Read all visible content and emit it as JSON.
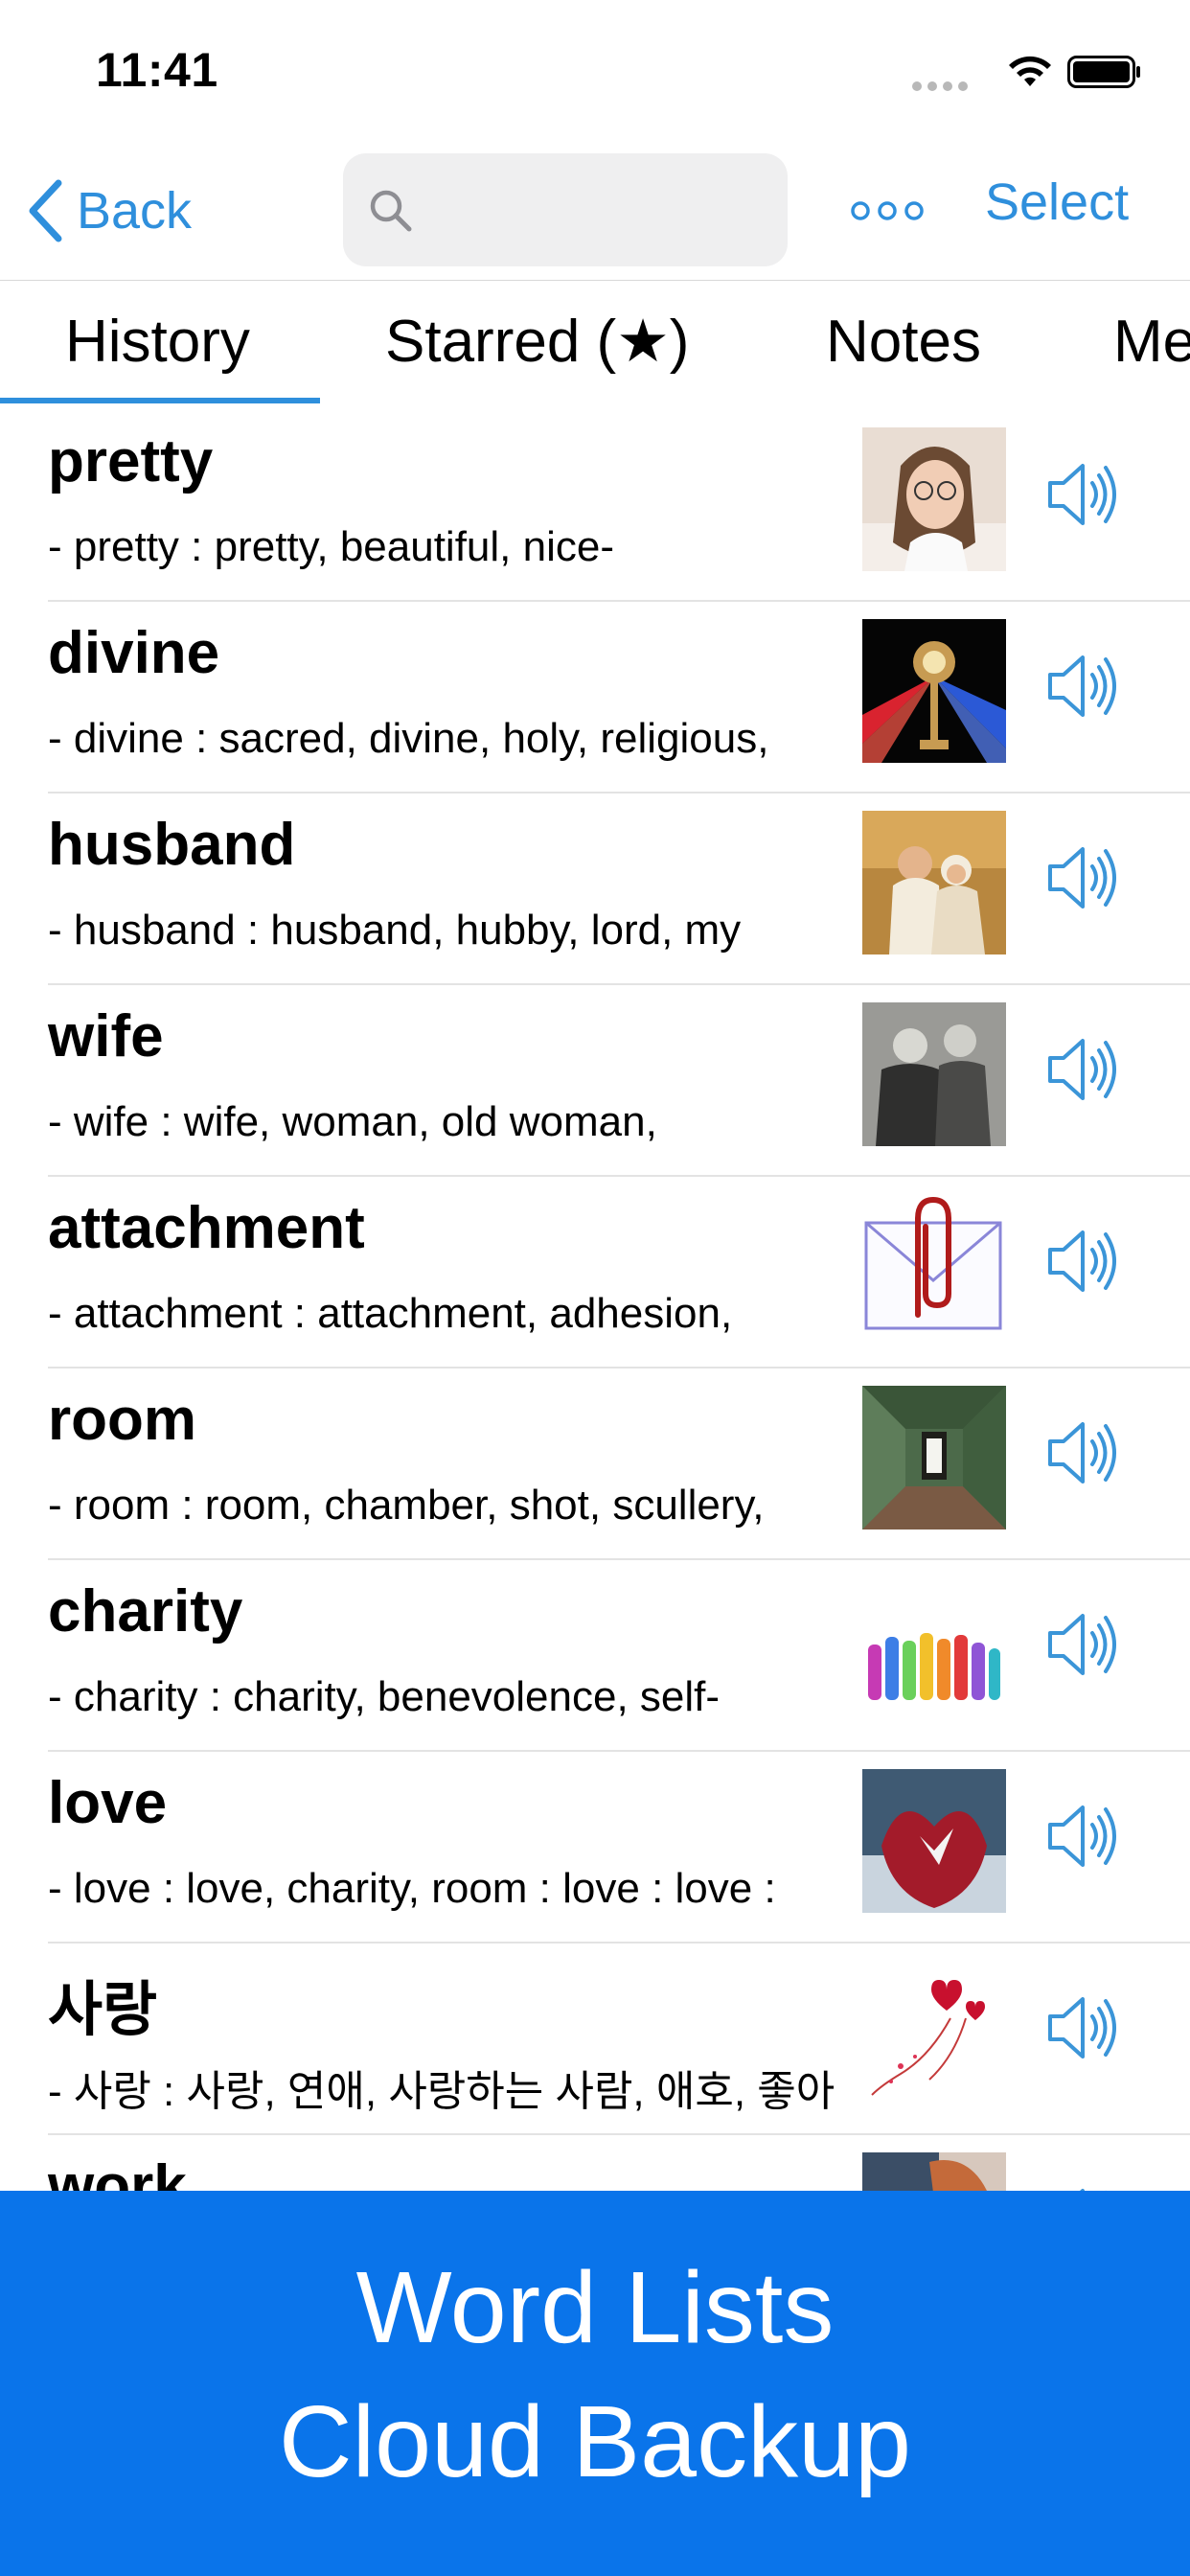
{
  "status": {
    "time": "11:41"
  },
  "nav": {
    "back_label": "Back",
    "search_placeholder": "",
    "select_label": "Select"
  },
  "tabs": [
    {
      "label": "History",
      "active": true
    },
    {
      "label": "Starred (★)",
      "active": false
    },
    {
      "label": "Notes",
      "active": false
    },
    {
      "label": "Me",
      "active": false
    }
  ],
  "words": [
    {
      "word": "pretty",
      "definition": "- pretty : pretty, beautiful, nice-",
      "image": "woman-photo"
    },
    {
      "word": "divine",
      "definition": "- divine : sacred, divine, holy, religious,",
      "image": "divine-light-photo"
    },
    {
      "word": "husband",
      "definition": "- husband : husband, hubby, lord, my",
      "image": "couple-photo"
    },
    {
      "word": "wife",
      "definition": "- wife : wife, woman, old woman,",
      "image": "old-couple-photo"
    },
    {
      "word": "attachment",
      "definition": "- attachment : attachment, adhesion,",
      "image": "paperclip-envelope"
    },
    {
      "word": "room",
      "definition": "- room : room, chamber, shot, scullery,",
      "image": "room-photo"
    },
    {
      "word": "charity",
      "definition": "- charity : charity, benevolence, self-",
      "image": "hands-illustration"
    },
    {
      "word": "love",
      "definition": "- love : love, charity, room : love : love :",
      "image": "heart-photo"
    },
    {
      "word": "사랑",
      "definition": "- 사랑 : 사랑, 연애, 사랑하는 사람, 애호, 좋아",
      "image": "hearts-illustration"
    },
    {
      "word": "work",
      "definition": "",
      "image": "work-photo"
    }
  ],
  "banner": {
    "line1": "Word Lists",
    "line2": "Cloud Backup"
  },
  "colors": {
    "accent": "#2f8fdc",
    "banner": "#0a74ea"
  }
}
